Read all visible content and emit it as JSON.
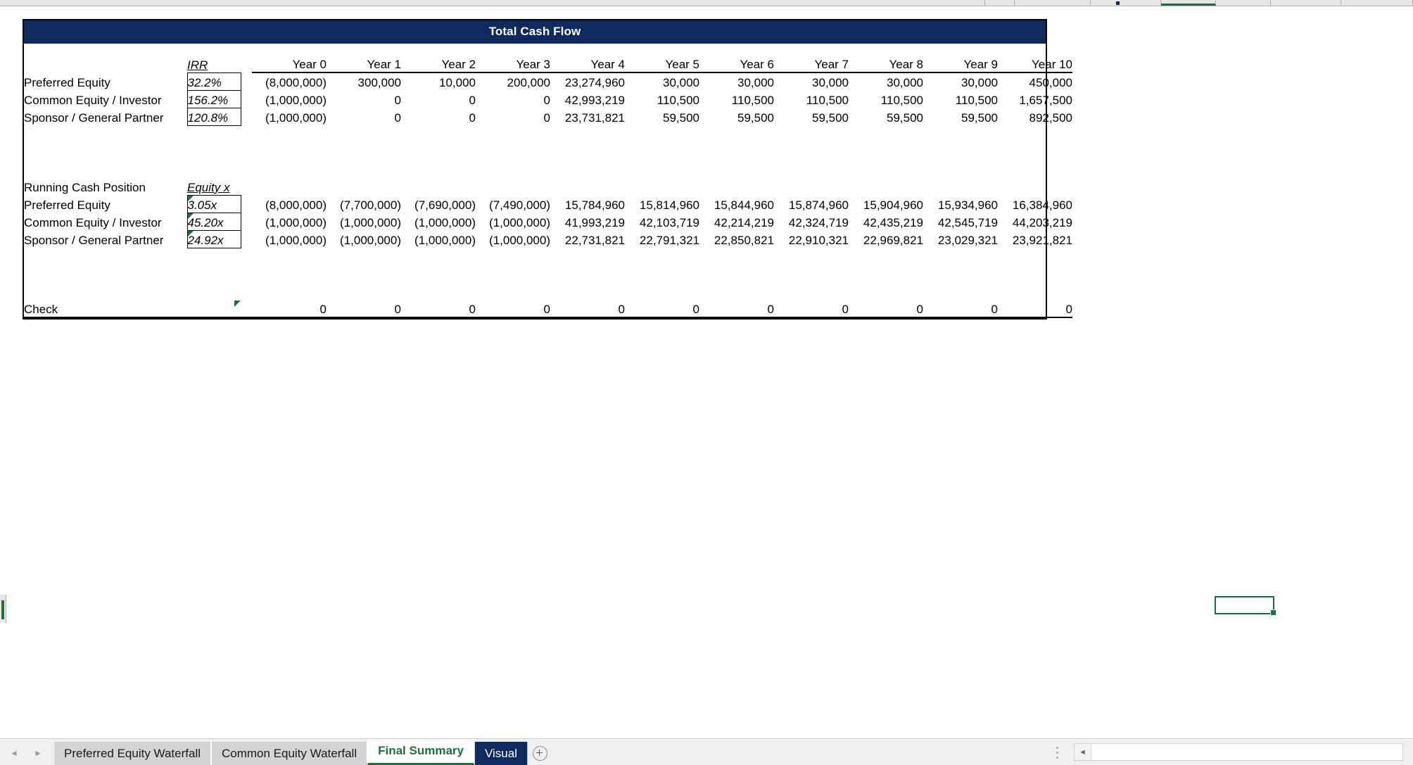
{
  "window": {
    "app": "spreadsheet"
  },
  "report": {
    "title": "Total Cash Flow",
    "sections": [
      {
        "id": "total_cash_flow",
        "heading": "",
        "metric_header": "IRR",
        "year_headers": [
          "Year 0",
          "Year 1",
          "Year 2",
          "Year 3",
          "Year 4",
          "Year 5",
          "Year 6",
          "Year 7",
          "Year 8",
          "Year 9",
          "Year 10"
        ],
        "rows": [
          {
            "label": "Preferred Equity",
            "metric": "32.2%",
            "values": [
              "(8,000,000)",
              "300,000",
              "10,000",
              "200,000",
              "23,274,960",
              "30,000",
              "30,000",
              "30,000",
              "30,000",
              "30,000",
              "450,000"
            ]
          },
          {
            "label": "Common Equity / Investor",
            "metric": "156.2%",
            "values": [
              "(1,000,000)",
              "0",
              "0",
              "0",
              "42,993,219",
              "110,500",
              "110,500",
              "110,500",
              "110,500",
              "110,500",
              "1,657,500"
            ]
          },
          {
            "label": "Sponsor / General Partner",
            "metric": "120.8%",
            "values": [
              "(1,000,000)",
              "0",
              "0",
              "0",
              "23,731,821",
              "59,500",
              "59,500",
              "59,500",
              "59,500",
              "59,500",
              "892,500"
            ]
          }
        ]
      },
      {
        "id": "running_cash_position",
        "heading": "Running Cash Position",
        "metric_header": "Equity x",
        "rows": [
          {
            "label": "Preferred Equity",
            "metric": "3.05x",
            "values": [
              "(8,000,000)",
              "(7,700,000)",
              "(7,690,000)",
              "(7,490,000)",
              "15,784,960",
              "15,814,960",
              "15,844,960",
              "15,874,960",
              "15,904,960",
              "15,934,960",
              "16,384,960"
            ]
          },
          {
            "label": "Common Equity / Investor",
            "metric": "45.20x",
            "values": [
              "(1,000,000)",
              "(1,000,000)",
              "(1,000,000)",
              "(1,000,000)",
              "41,993,219",
              "42,103,719",
              "42,214,219",
              "42,324,719",
              "42,435,219",
              "42,545,719",
              "44,203,219"
            ]
          },
          {
            "label": "Sponsor / General Partner",
            "metric": "24.92x",
            "values": [
              "(1,000,000)",
              "(1,000,000)",
              "(1,000,000)",
              "(1,000,000)",
              "22,731,821",
              "22,791,321",
              "22,850,821",
              "22,910,321",
              "22,969,821",
              "23,029,321",
              "23,921,821"
            ]
          }
        ]
      }
    ],
    "check": {
      "label": "Check",
      "values": [
        "0",
        "0",
        "0",
        "0",
        "0",
        "0",
        "0",
        "0",
        "0",
        "0",
        "0"
      ]
    }
  },
  "colors": {
    "header_navy": "#0e2a5e",
    "accent_green": "#1d6f42",
    "tab_inactive": "#d4d4d4"
  },
  "sheet_tabs": {
    "items": [
      {
        "label": "Preferred Equity Waterfall",
        "state": "inactive"
      },
      {
        "label": "Common Equity Waterfall",
        "state": "inactive"
      },
      {
        "label": "Final Summary",
        "state": "active"
      },
      {
        "label": "Visual",
        "state": "navy"
      }
    ],
    "add_label": "+",
    "nav_prev": "◄",
    "nav_next": "►"
  },
  "scrollbar": {
    "left_arrow": "◄"
  }
}
